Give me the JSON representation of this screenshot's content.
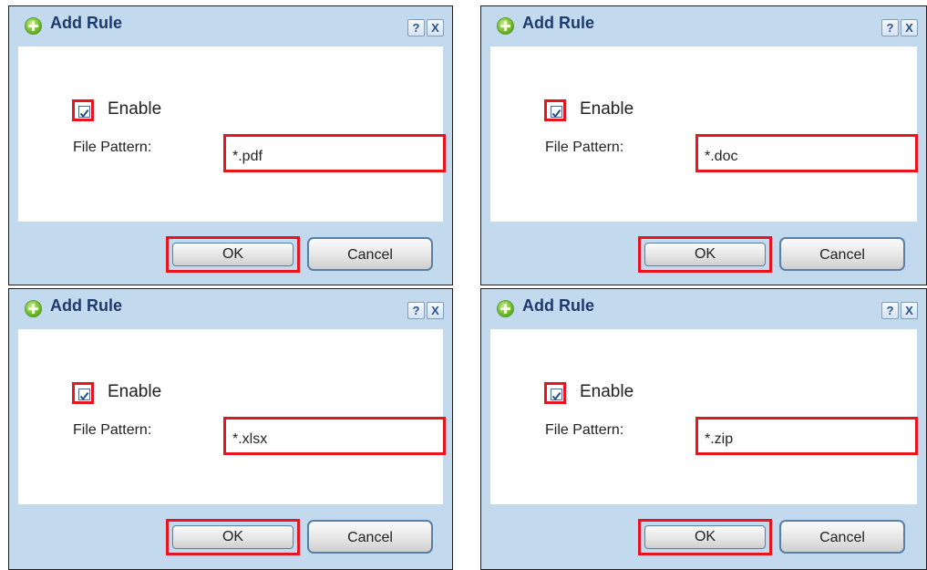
{
  "dialogs": [
    {
      "title": "Add Rule",
      "help_label": "?",
      "close_label": "X",
      "enable_label": "Enable",
      "enable_checked": true,
      "file_pattern_label": "File Pattern:",
      "file_pattern_value": "*.pdf",
      "ok_label": "OK",
      "cancel_label": "Cancel"
    },
    {
      "title": "Add Rule",
      "help_label": "?",
      "close_label": "X",
      "enable_label": "Enable",
      "enable_checked": true,
      "file_pattern_label": "File Pattern:",
      "file_pattern_value": "*.doc",
      "ok_label": "OK",
      "cancel_label": "Cancel"
    },
    {
      "title": "Add Rule",
      "help_label": "?",
      "close_label": "X",
      "enable_label": "Enable",
      "enable_checked": true,
      "file_pattern_label": "File Pattern:",
      "file_pattern_value": "*.xlsx",
      "ok_label": "OK",
      "cancel_label": "Cancel"
    },
    {
      "title": "Add Rule",
      "help_label": "?",
      "close_label": "X",
      "enable_label": "Enable",
      "enable_checked": true,
      "file_pattern_label": "File Pattern:",
      "file_pattern_value": "*.zip",
      "ok_label": "OK",
      "cancel_label": "Cancel"
    }
  ],
  "colors": {
    "highlight": "#e8141e",
    "dialog_background": "#c3d9ee",
    "title_text": "#1c3a6c",
    "add_icon": "#74bd33"
  }
}
